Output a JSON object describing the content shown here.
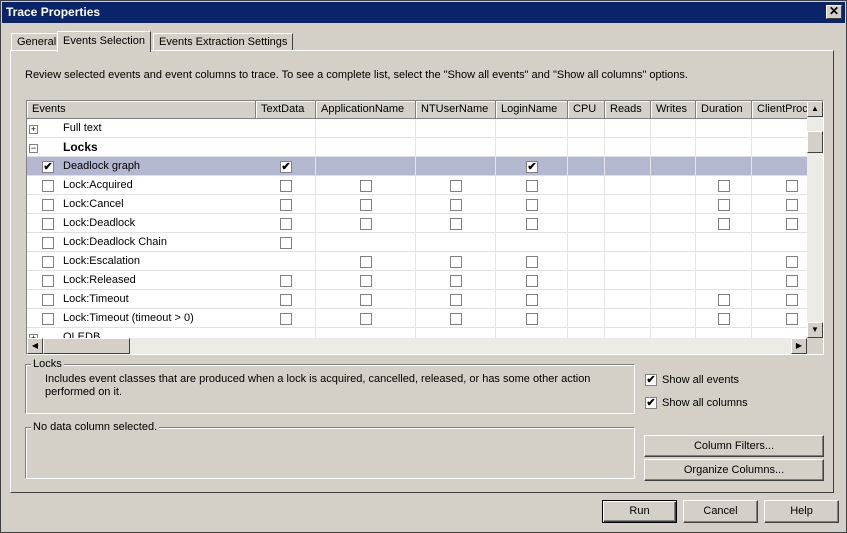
{
  "window": {
    "title": "Trace Properties",
    "close_glyph": "✕"
  },
  "tabs": [
    {
      "label": "General"
    },
    {
      "label": "Events Selection"
    },
    {
      "label": "Events Extraction Settings"
    }
  ],
  "intro_text": "Review selected events and event columns to trace. To see a complete list, select the \"Show all events\" and \"Show all columns\" options.",
  "grid": {
    "columns": [
      "Events",
      "TextData",
      "ApplicationName",
      "NTUserName",
      "LoginName",
      "CPU",
      "Reads",
      "Writes",
      "Duration",
      "ClientProc"
    ],
    "rows": [
      {
        "type": "group",
        "label": "Full text",
        "expander": "+",
        "bold": false,
        "checks": []
      },
      {
        "type": "group",
        "label": "Locks",
        "expander": "−",
        "bold": true,
        "checks": []
      },
      {
        "type": "event",
        "label": "Deadlock graph",
        "selected": true,
        "first": true,
        "checks": [
          [
            1,
            true
          ],
          [
            4,
            true
          ]
        ]
      },
      {
        "type": "event",
        "label": "Lock:Acquired",
        "first": false,
        "checks": [
          [
            1,
            false
          ],
          [
            2,
            false
          ],
          [
            3,
            false
          ],
          [
            4,
            false
          ],
          [
            8,
            false
          ],
          [
            9,
            false
          ]
        ]
      },
      {
        "type": "event",
        "label": "Lock:Cancel",
        "first": false,
        "checks": [
          [
            1,
            false
          ],
          [
            2,
            false
          ],
          [
            3,
            false
          ],
          [
            4,
            false
          ],
          [
            8,
            false
          ],
          [
            9,
            false
          ]
        ]
      },
      {
        "type": "event",
        "label": "Lock:Deadlock",
        "first": false,
        "checks": [
          [
            1,
            false
          ],
          [
            2,
            false
          ],
          [
            3,
            false
          ],
          [
            4,
            false
          ],
          [
            8,
            false
          ],
          [
            9,
            false
          ]
        ]
      },
      {
        "type": "event",
        "label": "Lock:Deadlock Chain",
        "first": false,
        "checks": [
          [
            1,
            false
          ]
        ]
      },
      {
        "type": "event",
        "label": "Lock:Escalation",
        "first": false,
        "checks": [
          [
            2,
            false
          ],
          [
            3,
            false
          ],
          [
            4,
            false
          ],
          [
            9,
            false
          ]
        ]
      },
      {
        "type": "event",
        "label": "Lock:Released",
        "first": false,
        "checks": [
          [
            1,
            false
          ],
          [
            2,
            false
          ],
          [
            3,
            false
          ],
          [
            4,
            false
          ],
          [
            9,
            false
          ]
        ]
      },
      {
        "type": "event",
        "label": "Lock:Timeout",
        "first": false,
        "checks": [
          [
            1,
            false
          ],
          [
            2,
            false
          ],
          [
            3,
            false
          ],
          [
            4,
            false
          ],
          [
            8,
            false
          ],
          [
            9,
            false
          ]
        ]
      },
      {
        "type": "event",
        "label": "Lock:Timeout (timeout > 0)",
        "first": false,
        "checks": [
          [
            1,
            false
          ],
          [
            2,
            false
          ],
          [
            3,
            false
          ],
          [
            4,
            false
          ],
          [
            8,
            false
          ],
          [
            9,
            false
          ]
        ]
      },
      {
        "type": "group",
        "label": "OLEDB",
        "expander": "+",
        "bold": false,
        "checks": []
      }
    ]
  },
  "description_box": {
    "title": "Locks",
    "text": "Includes event classes that are produced when a lock is acquired, cancelled, released, or has some other action performed on it."
  },
  "show_all_events": {
    "label": "Show all events",
    "checked": true
  },
  "show_all_columns": {
    "label": "Show all columns",
    "checked": true
  },
  "column_box": {
    "title": "No data column selected."
  },
  "buttons": {
    "column_filters": "Column Filters...",
    "organize_columns": "Organize Columns...",
    "run": "Run",
    "cancel": "Cancel",
    "help": "Help"
  },
  "check_glyph": "✔",
  "scroll": {
    "up": "▲",
    "down": "▼",
    "left": "◀",
    "right": "▶"
  }
}
